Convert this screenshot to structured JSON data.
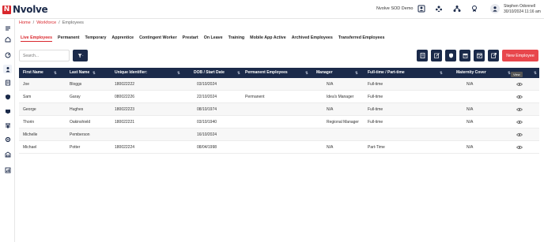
{
  "brand": {
    "logo_letter": "N",
    "name": "Nvolve"
  },
  "header": {
    "tenant": "Nvolve SOD Demo",
    "user_name": "Stephen Odonnell",
    "user_datetime": "30/10/2024 11:16 am"
  },
  "breadcrumb": [
    "Home",
    "/",
    "Workforce",
    "/",
    "Employees"
  ],
  "tabs": [
    "Live Employees",
    "Permanent",
    "Temporary",
    "Apprentice",
    "Contingent Worker",
    "Prestart",
    "On Leave",
    "Training",
    "Mobile App Active",
    "Archived Employees",
    "Transferred Employees"
  ],
  "toolbar": {
    "search_placeholder": "Search...",
    "new_employee_label": "New Employee"
  },
  "table": {
    "columns": [
      "First Name",
      "Last Name",
      "Unique Identifier:",
      "DOB / Start Date",
      "Permanent Employees",
      "Manager",
      "Full-time / Part-time",
      "Maternity Cover"
    ],
    "rows": [
      [
        "Joe",
        "Bloggs",
        "180022222",
        "03/10/2024",
        "",
        "N/A",
        "Full-time",
        "N/A"
      ],
      [
        "Sam",
        "Garay",
        "080022226",
        "22/10/2024",
        "Permanent",
        "Idea's Manager",
        "Full-time",
        ""
      ],
      [
        "George",
        "Hughes",
        "180022223",
        "08/10/1974",
        "",
        "N/A",
        "Full-time",
        "N/A"
      ],
      [
        "Thorin",
        "Oakinshield",
        "180022221",
        "03/10/1940",
        "",
        "Regional Manager",
        "Full-time",
        "N/A"
      ],
      [
        "Michelle",
        "Pemberson",
        "",
        "16/10/2024",
        "",
        "",
        "",
        ""
      ],
      [
        "Michael",
        "Potter",
        "180022224",
        "08/04/1998",
        "",
        "N/A",
        "Part-Time",
        "N/A"
      ]
    ]
  },
  "tooltip": "View",
  "colors": {
    "navy": "#1b2a4a",
    "red": "#d9262c",
    "button_red": "#e8474c"
  }
}
